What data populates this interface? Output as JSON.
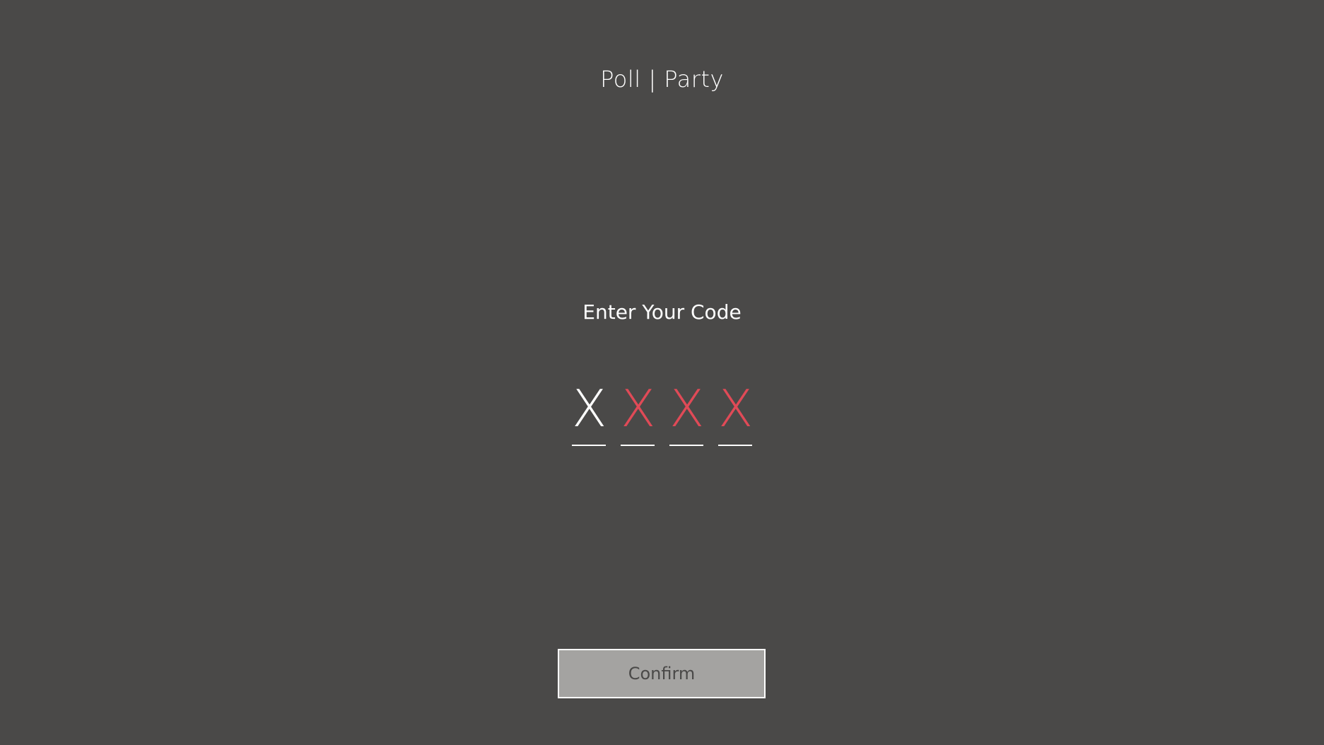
{
  "header": {
    "title": "Poll | Party"
  },
  "code_entry": {
    "prompt": "Enter Your Code",
    "slots": [
      {
        "value": "X",
        "color": "#ffffff"
      },
      {
        "value": "X",
        "color": "#e04a57"
      },
      {
        "value": "X",
        "color": "#e04a57"
      },
      {
        "value": "X",
        "color": "#e04a57"
      }
    ]
  },
  "actions": {
    "confirm_label": "Confirm"
  },
  "colors": {
    "background": "#4a4948",
    "text": "#ffffff",
    "error": "#e04a57",
    "button_fill": "#a4a3a1"
  }
}
